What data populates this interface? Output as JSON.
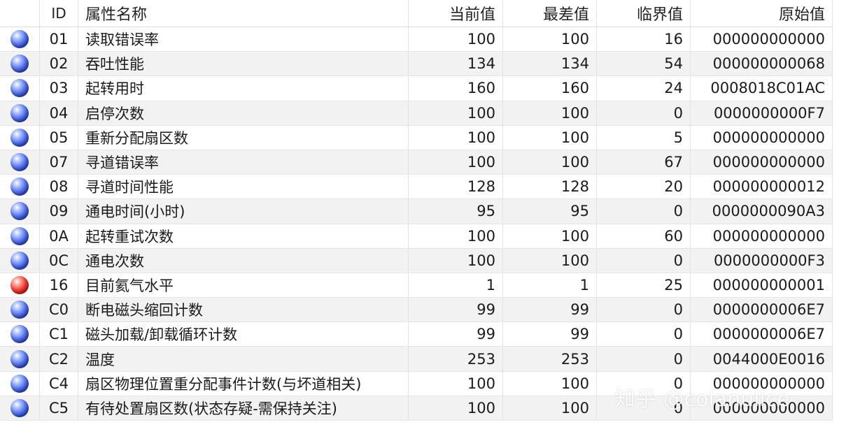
{
  "headers": {
    "id": "ID",
    "name": "属性名称",
    "current": "当前值",
    "worst": "最差值",
    "threshold": "临界值",
    "raw": "原始值"
  },
  "status_colors": {
    "good": "#3f5fe0",
    "bad": "#e52a20"
  },
  "rows": [
    {
      "status": "good",
      "id": "01",
      "name": "读取错误率",
      "current": "100",
      "worst": "100",
      "threshold": "16",
      "raw": "000000000000"
    },
    {
      "status": "good",
      "id": "02",
      "name": "吞吐性能",
      "current": "134",
      "worst": "134",
      "threshold": "54",
      "raw": "000000000068"
    },
    {
      "status": "good",
      "id": "03",
      "name": "起转用时",
      "current": "160",
      "worst": "160",
      "threshold": "24",
      "raw": "0008018C01AC"
    },
    {
      "status": "good",
      "id": "04",
      "name": "启停次数",
      "current": "100",
      "worst": "100",
      "threshold": "0",
      "raw": "0000000000F7"
    },
    {
      "status": "good",
      "id": "05",
      "name": "重新分配扇区数",
      "current": "100",
      "worst": "100",
      "threshold": "5",
      "raw": "000000000000"
    },
    {
      "status": "good",
      "id": "07",
      "name": "寻道错误率",
      "current": "100",
      "worst": "100",
      "threshold": "67",
      "raw": "000000000000"
    },
    {
      "status": "good",
      "id": "08",
      "name": "寻道时间性能",
      "current": "128",
      "worst": "128",
      "threshold": "20",
      "raw": "000000000012"
    },
    {
      "status": "good",
      "id": "09",
      "name": "通电时间(小时)",
      "current": "95",
      "worst": "95",
      "threshold": "0",
      "raw": "0000000090A3"
    },
    {
      "status": "good",
      "id": "0A",
      "name": "起转重试次数",
      "current": "100",
      "worst": "100",
      "threshold": "60",
      "raw": "000000000000"
    },
    {
      "status": "good",
      "id": "0C",
      "name": "通电次数",
      "current": "100",
      "worst": "100",
      "threshold": "0",
      "raw": "0000000000F3"
    },
    {
      "status": "bad",
      "id": "16",
      "name": "目前氦气水平",
      "current": "1",
      "worst": "1",
      "threshold": "25",
      "raw": "000000000001"
    },
    {
      "status": "good",
      "id": "C0",
      "name": "断电磁头缩回计数",
      "current": "99",
      "worst": "99",
      "threshold": "0",
      "raw": "0000000006E7"
    },
    {
      "status": "good",
      "id": "C1",
      "name": "磁头加载/卸载循环计数",
      "current": "99",
      "worst": "99",
      "threshold": "0",
      "raw": "0000000006E7"
    },
    {
      "status": "good",
      "id": "C2",
      "name": "温度",
      "current": "253",
      "worst": "253",
      "threshold": "0",
      "raw": "0044000E0016"
    },
    {
      "status": "good",
      "id": "C4",
      "name": "扇区物理位置重分配事件计数(与坏道相关)",
      "current": "100",
      "worst": "100",
      "threshold": "0",
      "raw": "000000000000"
    },
    {
      "status": "good",
      "id": "C5",
      "name": "有待处置扇区数(状态存疑-需保持关注)",
      "current": "100",
      "worst": "100",
      "threshold": "0",
      "raw": "000000000000"
    }
  ],
  "watermark": "知乎 @colanullce"
}
